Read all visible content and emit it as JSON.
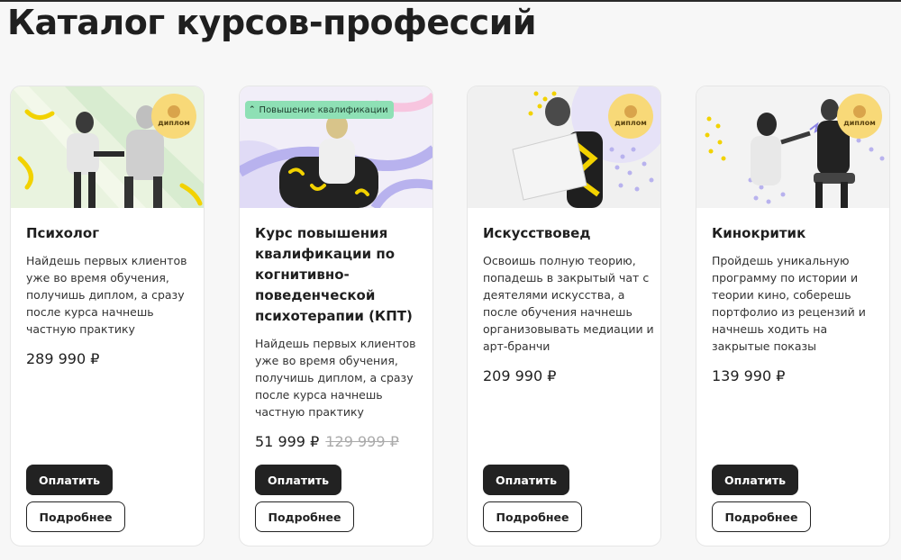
{
  "page": {
    "title": "Каталог курсов-профессий"
  },
  "badges": {
    "diploma": "диплом",
    "upskill": "Повышение квалификации"
  },
  "cards": [
    {
      "title": "Психолог",
      "description": "Найдешь первых клиентов уже во время обучения, получишь диплом, а сразу после курса начнешь частную практику",
      "price": "289 990 ₽",
      "old_price": "",
      "pay_label": "Оплатить",
      "more_label": "Подробнее"
    },
    {
      "title": "Курс повышения квалификации по когнитивно-поведенческой психотерапии (КПТ)",
      "description": "Найдешь первых клиентов уже во время обучения, получишь диплом, а сразу после курса начнешь частную практику",
      "price": "51 999 ₽",
      "old_price": "129 999 ₽",
      "pay_label": "Оплатить",
      "more_label": "Подробнее"
    },
    {
      "title": "Искусствовед",
      "description": "Освоишь полную теорию, попадешь в закрытый чат с деятелями искусства, а после обучения начнешь организовывать медиации и арт-бранчи",
      "price": "209 990 ₽",
      "old_price": "",
      "pay_label": "Оплатить",
      "more_label": "Подробнее"
    },
    {
      "title": "Кинокритик",
      "description": "Пройдешь уникальную программу по истории и теории кино, соберешь портфолио из рецензий и начнешь ходить на закрытые показы",
      "price": "139 990 ₽",
      "old_price": "",
      "pay_label": "Оплатить",
      "more_label": "Подробнее"
    }
  ]
}
